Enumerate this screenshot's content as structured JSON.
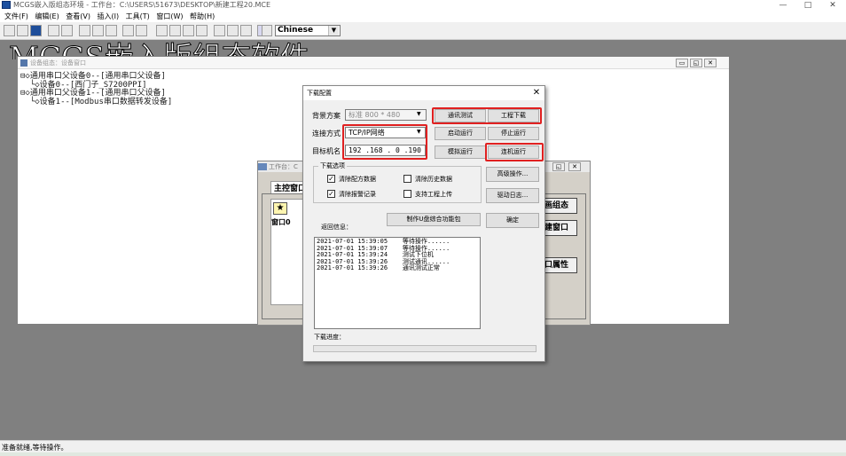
{
  "window": {
    "title": "MCGS嵌入版组态环境 - 工作台：C:\\USERS\\51673\\DESKTOP\\新建工程20.MCE",
    "minimize": "—",
    "maximize": "□",
    "close": "✕"
  },
  "menu": [
    "文件(F)",
    "编辑(E)",
    "查看(V)",
    "插入(I)",
    "工具(T)",
    "窗口(W)",
    "帮助(H)"
  ],
  "toolbar": {
    "language": "Chinese"
  },
  "banner": "MCGS嵌入版组态软件",
  "device_window": {
    "title": "设备组态：设备窗口",
    "tree": [
      "⊟◇通用串口父设备0--[通用串口父设备]",
      "  └◇设备0--[西门子_S7200PPI]",
      "⊟◇通用串口父设备1--[通用串口父设备]",
      "  └◇设备1--[Modbus串口数据转发设备]"
    ]
  },
  "main_window": {
    "title": "工作台：C",
    "tab_label": "主控窗口",
    "window_label": "窗口0",
    "buttons": [
      "画组态",
      "建窗口",
      "口属性"
    ]
  },
  "dialog": {
    "title": "下载配置",
    "close": "✕",
    "background_label": "背景方案",
    "background_value": "标准 800 * 480",
    "connection_label": "连接方式",
    "connection_value": "TCP/IP网络",
    "target_label": "目标机名",
    "target_ip": "192 .168 . 0  .190",
    "buttons": {
      "comm_test": "通讯测试",
      "download": "工程下载",
      "start": "启动运行",
      "stop": "停止运行",
      "simulate": "模拟运行",
      "online": "连机运行",
      "advanced": "高级操作...",
      "driver_log": "驱动日志...",
      "usb": "制作U盘综合功能包",
      "ok": "确定"
    },
    "options_group": "下载选项",
    "options": [
      {
        "label": "清除配方数据",
        "checked": true
      },
      {
        "label": "清除历史数据",
        "checked": false
      },
      {
        "label": "清除报警记录",
        "checked": true
      },
      {
        "label": "支持工程上传",
        "checked": false
      }
    ],
    "return_label": "返回信息：",
    "log": [
      "2021-07-01 15:39:05    等待操作......",
      "2021-07-01 15:39:07    等待操作......",
      "2021-07-01 15:39:24    测试下位机",
      "2021-07-01 15:39:26    测试通讯......",
      "2021-07-01 15:39:26    通讯测试正常"
    ],
    "progress_label": "下载进度：",
    "progress": 0
  },
  "status": "准备就绪,等待操作。",
  "colors": {
    "highlight": "#e02020",
    "workspace": "#808080"
  }
}
